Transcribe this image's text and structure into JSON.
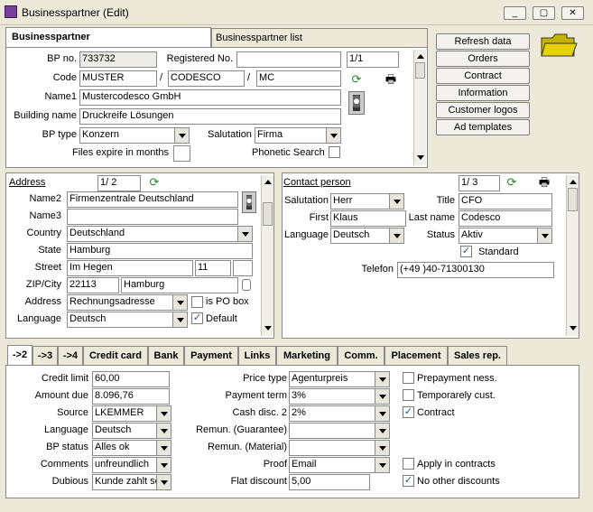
{
  "window": {
    "title": "Businesspartner (Edit)",
    "min": "_",
    "max": "▢",
    "close": "✕"
  },
  "tabs_top": {
    "active": "Businesspartner",
    "other": "Businesspartner list"
  },
  "bp": {
    "bpno_label": "BP no.",
    "bpno": "733732",
    "regno_label": "Registered No.",
    "regno": "",
    "page": "1/1",
    "code_label": "Code",
    "code1": "MUSTER",
    "code2": "CODESCO",
    "code3": "MC",
    "slash": "/",
    "name1_label": "Name1",
    "name1": "Mustercodesco GmbH",
    "building_label": "Building name",
    "building": "Druckreife Lösungen",
    "bptype_label": "BP type",
    "bptype": "Konzern",
    "salutation_label": "Salutation",
    "salutation": "Firma",
    "files_label": "Files expire in months",
    "files": "",
    "phonetic_label": "Phonetic Search"
  },
  "side_buttons": [
    "Refresh data",
    "Orders",
    "Contract",
    "Information",
    "Customer logos",
    "Ad templates"
  ],
  "address": {
    "title": "Address",
    "page": "1/ 2",
    "name2_label": "Name2",
    "name2": "Firmenzentrale Deutschland",
    "name3_label": "Name3",
    "name3": "",
    "country_label": "Country",
    "country": "Deutschland",
    "state_label": "State",
    "state": "Hamburg",
    "street_label": "Street",
    "street": "Im Hegen",
    "houseno": "11",
    "extra": "",
    "zip_label": "ZIP/City",
    "zip": "22113",
    "city": "Hamburg",
    "addrtype_label": "Address",
    "addrtype": "Rechnungsadresse",
    "pobox_label": "is PO box",
    "language_label": "Language",
    "language": "Deutsch",
    "default_label": "Default"
  },
  "contact": {
    "title": "Contact person",
    "page": "1/ 3",
    "salutation_label": "Salutation",
    "salutation": "Herr",
    "title_label": "Title",
    "title_val": "CFO",
    "first_label": "First",
    "first": "Klaus",
    "last_label": "Last name",
    "last": "Codesco",
    "language_label": "Language",
    "language": "Deutsch",
    "status_label": "Status",
    "status": "Aktiv",
    "standard_label": "Standard",
    "telefon_label": "Telefon",
    "telefon": "(+49  )40-71300130"
  },
  "bottom_tabs": [
    "->2",
    "->3",
    "->4",
    "Credit card",
    "Bank",
    "Payment",
    "Links",
    "Marketing",
    "Comm.",
    "Placement",
    "Sales rep."
  ],
  "finance": {
    "credit_label": "Credit limit",
    "credit": "60,00",
    "amount_label": "Amount due",
    "amount": "8.096,76",
    "source_label": "Source",
    "source": "LKEMMER",
    "language_label": "Language",
    "language": "Deutsch",
    "bpstatus_label": "BP  status",
    "bpstatus": "Alles ok",
    "comments_label": "Comments",
    "comments": "unfreundlich",
    "dubious_label": "Dubious",
    "dubious": "Kunde zahlt sc",
    "pricetype_label": "Price type",
    "pricetype": "Agenturpreis",
    "payterm_label": "Payment term",
    "payterm": "3%",
    "cashdisc_label": "Cash disc. 2",
    "cashdisc": "2%",
    "remun_g_label": "Remun. (Guarantee)",
    "remun_g": "",
    "remun_m_label": "Remun. (Material)",
    "remun_m": "",
    "proof_label": "Proof",
    "proof": "Email",
    "flat_label": "Flat discount",
    "flat": "5,00",
    "prepay_label": "Prepayment ness.",
    "temp_label": "Temporarely cust.",
    "contract_label": "Contract",
    "apply_label": "Apply in contracts",
    "nodisc_label": "No other discounts"
  }
}
